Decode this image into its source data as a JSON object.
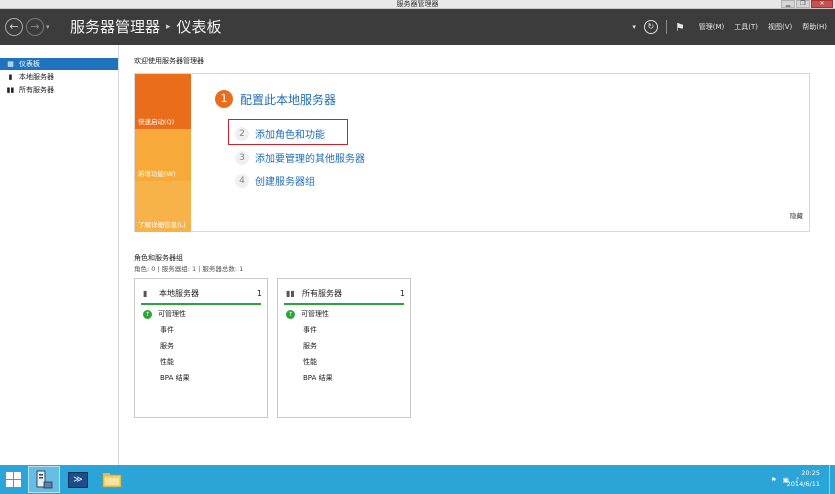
{
  "window": {
    "title": "服务器管理器",
    "minimize_glyph": "▁",
    "restore_glyph": "❐",
    "close_glyph": "✕"
  },
  "header": {
    "back_glyph": "←",
    "forward_glyph": "→",
    "dropdown_glyph": "▾",
    "breadcrumb_root": "服务器管理器",
    "breadcrumb_sep": "▸",
    "breadcrumb_current": "仪表板",
    "refresh_glyph": "↻",
    "flag_glyph": "⚑",
    "menus": [
      "管理(M)",
      "工具(T)",
      "视图(V)",
      "帮助(H)"
    ]
  },
  "sidebar": {
    "items": [
      {
        "label": "仪表板",
        "icon": "dashboard-icon",
        "glyph": "▦",
        "active": true
      },
      {
        "label": "本地服务器",
        "icon": "server-icon",
        "glyph": "▮",
        "active": false
      },
      {
        "label": "所有服务器",
        "icon": "servers-icon",
        "glyph": "▮▮",
        "active": false
      }
    ]
  },
  "welcome": {
    "label": "欢迎使用服务器管理器",
    "quick_links": [
      "快速启动(Q)",
      "新增功能(W)",
      "了解详细信息(L)"
    ],
    "steps": [
      {
        "num": "1",
        "text": "配置此本地服务器"
      },
      {
        "num": "2",
        "text": "添加角色和功能"
      },
      {
        "num": "3",
        "text": "添加要管理的其他服务器"
      },
      {
        "num": "4",
        "text": "创建服务器组"
      }
    ],
    "hide": "隐藏"
  },
  "roles": {
    "title": "角色和服务器组",
    "subtitle": "角色: 0 | 服务器组: 1 | 服务器总数: 1",
    "tiles": [
      {
        "name": "本地服务器",
        "count": "1",
        "rows": [
          "可管理性",
          "事件",
          "服务",
          "性能",
          "BPA 结果"
        ]
      },
      {
        "name": "所有服务器",
        "count": "1",
        "rows": [
          "可管理性",
          "事件",
          "服务",
          "性能",
          "BPA 结果"
        ]
      }
    ]
  },
  "taskbar": {
    "time": "20:25",
    "date": "2014/6/11",
    "powershell_glyph": "≫",
    "tray_flag": "⚑",
    "tray_volume": "♪"
  },
  "colors": {
    "header_bg": "#3c3c3c",
    "accent_blue": "#1e73be",
    "orange": "#ea6d1c",
    "light_orange": "#f7aa3a",
    "green": "#2aa53a",
    "highlight_red": "#d0202a",
    "taskbar": "#2ba5d8"
  }
}
